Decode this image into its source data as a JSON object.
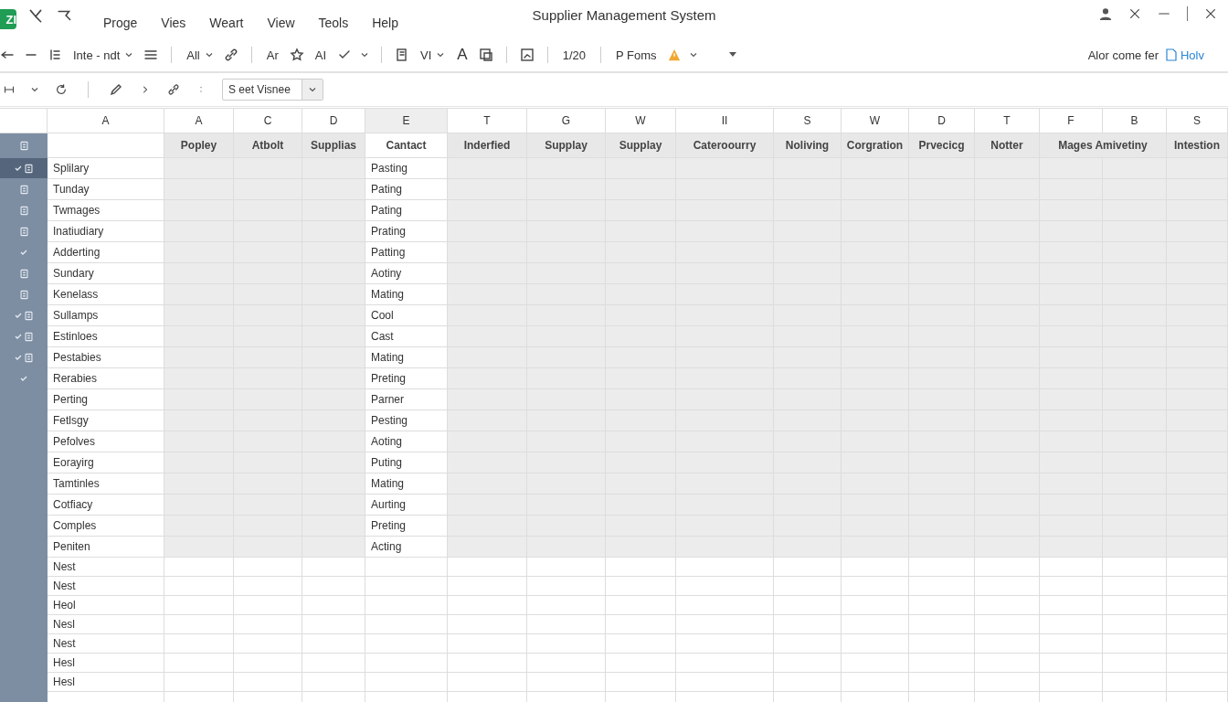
{
  "window": {
    "logo": "ZI",
    "title": "Supplier Management System"
  },
  "menu": [
    "Proge",
    "Vies",
    "Weart",
    "View",
    "Teols",
    "Help"
  ],
  "toolbar": {
    "items": [
      "Inte - ndt",
      "All",
      "Ar",
      "AI",
      "VI",
      "A",
      "1/20",
      "P Foms"
    ],
    "status_text": "Alor come fer",
    "help_link": "Holv"
  },
  "toolbar2": {
    "view_select": "S eet Visnee"
  },
  "grid": {
    "columns": [
      {
        "letter": "A",
        "selected": false
      },
      {
        "letter": "A",
        "selected": false
      },
      {
        "letter": "C",
        "selected": false
      },
      {
        "letter": "D",
        "selected": false
      },
      {
        "letter": "E",
        "selected": true
      },
      {
        "letter": "T",
        "selected": false
      },
      {
        "letter": "G",
        "selected": false
      },
      {
        "letter": "W",
        "selected": false
      },
      {
        "letter": "II",
        "selected": false
      },
      {
        "letter": "S",
        "selected": false
      },
      {
        "letter": "W",
        "selected": false
      },
      {
        "letter": "D",
        "selected": false
      },
      {
        "letter": "T",
        "selected": false
      },
      {
        "letter": "F",
        "selected": false
      },
      {
        "letter": "B",
        "selected": false
      },
      {
        "letter": "S",
        "selected": false
      }
    ],
    "headers": [
      {
        "label": "Popley",
        "kind": "single"
      },
      {
        "label": "Atbolt",
        "kind": "single"
      },
      {
        "label": "Supplias",
        "kind": "single"
      },
      {
        "label": "Cantact",
        "kind": "single"
      },
      {
        "label": "Inderfied",
        "kind": "single"
      },
      {
        "label": "Supplay",
        "kind": "single"
      },
      {
        "label": "Supplay",
        "kind": "single"
      },
      {
        "label": "Cateroourry",
        "kind": "single"
      },
      {
        "label": "Noliving",
        "kind": "single"
      },
      {
        "label": "Corgration",
        "kind": "single"
      },
      {
        "label": "Prvecicg",
        "kind": "single"
      },
      {
        "label": "Notter",
        "kind": "single"
      },
      {
        "label": "Mages Amivetiny",
        "kind": "merged"
      },
      {
        "label": "Intestion",
        "kind": "single"
      }
    ],
    "rows": [
      {
        "name": "Splilary",
        "contact": "Pasting",
        "kind": "icon",
        "checked": true,
        "selected": true
      },
      {
        "name": "Tunday",
        "contact": "Pating",
        "kind": "icon",
        "checked": false,
        "selected": false
      },
      {
        "name": "Twmages",
        "contact": "Pating",
        "kind": "icon",
        "checked": false,
        "selected": false
      },
      {
        "name": "Inatiudiary",
        "contact": "Prating",
        "kind": "icon",
        "checked": false,
        "selected": false
      },
      {
        "name": "Adderting",
        "contact": "Patting",
        "kind": "none",
        "checked": true,
        "selected": false
      },
      {
        "name": "Sundary",
        "contact": "Aotiny",
        "kind": "icon",
        "checked": false,
        "selected": false
      },
      {
        "name": "Kenelass",
        "contact": "Mating",
        "kind": "icon",
        "checked": false,
        "selected": false
      },
      {
        "name": "Sullamps",
        "contact": "Cool",
        "kind": "icon",
        "checked": true,
        "selected": false
      },
      {
        "name": "Estinloes",
        "contact": "Cast",
        "kind": "icon",
        "checked": true,
        "selected": false
      },
      {
        "name": "Pestabies",
        "contact": "Mating",
        "kind": "icon",
        "checked": true,
        "selected": false
      },
      {
        "name": "Rerabies",
        "contact": "Preting",
        "kind": "none",
        "checked": true,
        "selected": false
      },
      {
        "name": "Perting",
        "contact": "Parner",
        "kind": "none",
        "checked": false,
        "selected": false
      },
      {
        "name": "Fetlsgy",
        "contact": "Pesting",
        "kind": "none",
        "checked": false,
        "selected": false
      },
      {
        "name": "Pefolves",
        "contact": "Aoting",
        "kind": "none",
        "checked": false,
        "selected": false
      },
      {
        "name": "Eorayirg",
        "contact": "Puting",
        "kind": "none",
        "checked": false,
        "selected": false
      },
      {
        "name": "Tamtinles",
        "contact": "Mating",
        "kind": "none",
        "checked": false,
        "selected": false
      },
      {
        "name": "Cotfiacy",
        "contact": "Aurting",
        "kind": "none",
        "checked": false,
        "selected": false
      },
      {
        "name": "Comples",
        "contact": "Preting",
        "kind": "none",
        "checked": false,
        "selected": false
      },
      {
        "name": "Peniten",
        "contact": "Acting",
        "kind": "none",
        "checked": false,
        "selected": false
      }
    ],
    "blank_rows": [
      "Nest",
      "Nest",
      "Heol",
      "Nesl",
      "Nest",
      "Hesl",
      "Hesl"
    ]
  }
}
